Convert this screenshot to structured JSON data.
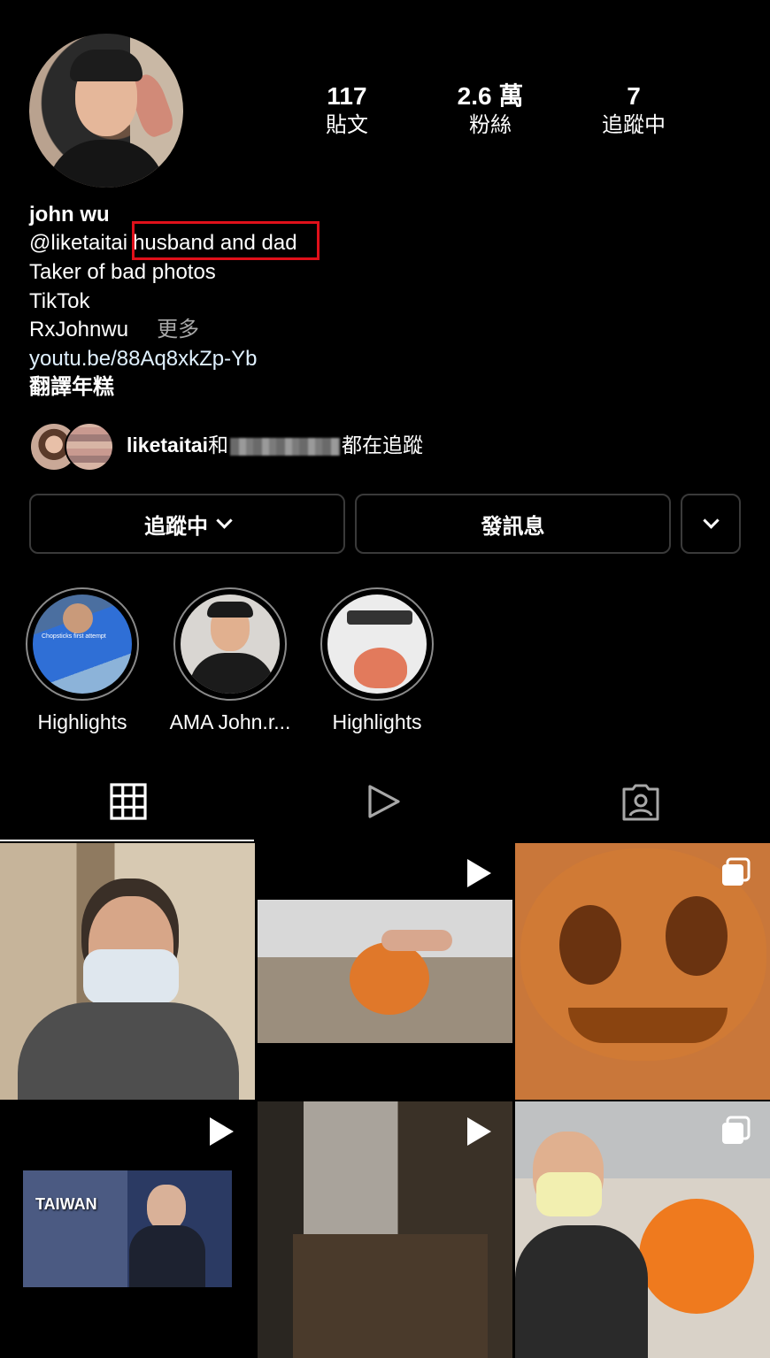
{
  "profile": {
    "name": "john wu",
    "mention": "@liketaitai",
    "highlighted_bio": "husband and dad",
    "bio_lines": [
      "Taker of bad photos",
      "TikTok"
    ],
    "bio_last": "RxJohnwu",
    "more_label": "更多",
    "link": "youtu.be/88Aq8xkZp-Yb",
    "translate_label": "翻譯年糕"
  },
  "stats": [
    {
      "value": "117",
      "label": "貼文"
    },
    {
      "value": "2.6 萬",
      "label": "粉絲"
    },
    {
      "value": "7",
      "label": "追蹤中"
    }
  ],
  "followed_by": {
    "user": "liketaitai",
    "joiner": "和",
    "suffix": "都在追蹤"
  },
  "buttons": {
    "following": "追蹤中",
    "message": "發訊息"
  },
  "highlights": [
    {
      "label": "Highlights",
      "overlay_text": "Chopsticks first attempt"
    },
    {
      "label": "AMA John.r..."
    },
    {
      "label": "Highlights"
    }
  ],
  "tabs": [
    "grid-icon",
    "reels-icon",
    "tagged-icon"
  ],
  "posts": [
    {
      "type": "photo"
    },
    {
      "type": "video"
    },
    {
      "type": "carousel"
    },
    {
      "type": "video",
      "overlay_text": "TAIWAN"
    },
    {
      "type": "video"
    },
    {
      "type": "carousel"
    }
  ],
  "colors": {
    "background": "#000000",
    "highlight_box": "#e0101a",
    "button_border": "#3a3a3a"
  }
}
